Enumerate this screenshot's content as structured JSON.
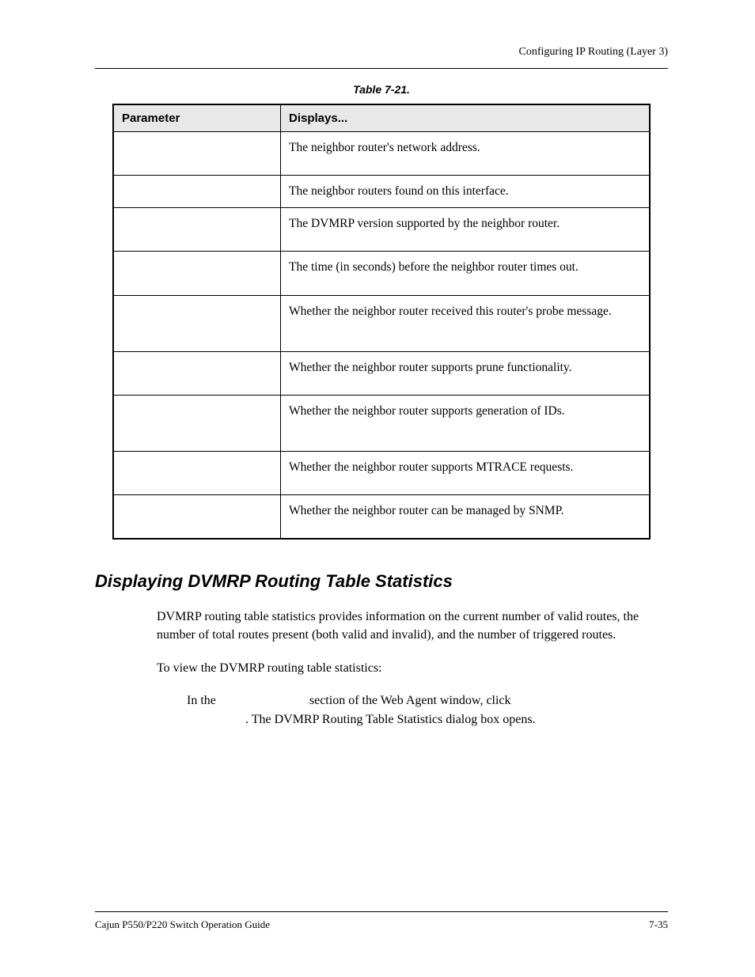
{
  "header": {
    "chapter_title": "Configuring IP Routing (Layer 3)"
  },
  "table": {
    "caption": "Table 7-21.",
    "headers": {
      "col1": "Parameter",
      "col2": "Displays..."
    },
    "rows": [
      {
        "param": "",
        "disp": "The neighbor router's network address."
      },
      {
        "param": "",
        "disp": "The neighbor routers found on this interface."
      },
      {
        "param": "",
        "disp": "The DVMRP version supported by the neighbor router."
      },
      {
        "param": "",
        "disp": "The time (in seconds) before the neighbor router times out."
      },
      {
        "param": "",
        "disp": "Whether the neighbor router received this router's probe message."
      },
      {
        "param": "",
        "disp": "Whether the neighbor router supports prune functionality."
      },
      {
        "param": "",
        "disp": "Whether the neighbor router supports generation of IDs."
      },
      {
        "param": "",
        "disp": "Whether the neighbor router supports MTRACE requests."
      },
      {
        "param": "",
        "disp": "Whether the neighbor router can be managed by SNMP."
      }
    ]
  },
  "section": {
    "heading": "Displaying DVMRP Routing Table Statistics",
    "para1": "DVMRP routing table statistics provides information on the current number of valid routes, the number of total routes present (both valid and invalid), and the number of triggered routes.",
    "para2": "To view the DVMRP routing table statistics:",
    "step_pre": "In the ",
    "step_mid": " section of the Web Agent window, click ",
    "step_post": ". The DVMRP Routing Table Statistics dialog box opens."
  },
  "footer": {
    "left": "Cajun P550/P220 Switch Operation Guide",
    "right": "7-35"
  }
}
